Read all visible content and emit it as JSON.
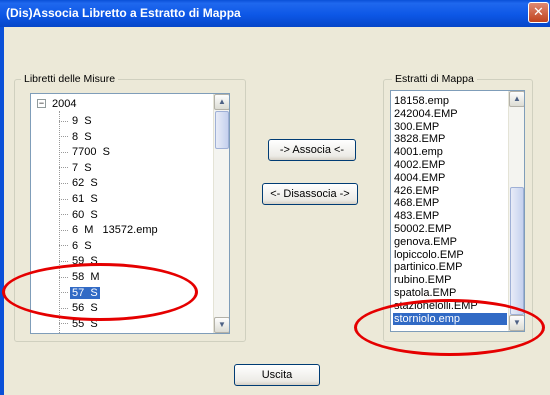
{
  "window": {
    "title": "(Dis)Associa Libretto a Estratto di Mappa",
    "close_glyph": "✕"
  },
  "left_group": {
    "label": "Libretti delle Misure",
    "root": {
      "expander": "−",
      "label": "2004"
    },
    "items": [
      {
        "label": "9  S",
        "selected": false
      },
      {
        "label": "8  S",
        "selected": false
      },
      {
        "label": "7700  S",
        "selected": false
      },
      {
        "label": "7  S",
        "selected": false
      },
      {
        "label": "62  S",
        "selected": false
      },
      {
        "label": "61  S",
        "selected": false
      },
      {
        "label": "60  S",
        "selected": false
      },
      {
        "label": "6  M   13572.emp",
        "selected": false
      },
      {
        "label": "6  S",
        "selected": false
      },
      {
        "label": "59  S",
        "selected": false
      },
      {
        "label": "58  M",
        "selected": false
      },
      {
        "label": "57  S",
        "selected": true
      },
      {
        "label": "56  S",
        "selected": false
      },
      {
        "label": "55  S",
        "selected": false
      }
    ]
  },
  "right_group": {
    "label": "Estratti di Mappa",
    "items": [
      {
        "label": "18158.emp",
        "selected": false
      },
      {
        "label": "242004.EMP",
        "selected": false
      },
      {
        "label": "300.EMP",
        "selected": false
      },
      {
        "label": "3828.EMP",
        "selected": false
      },
      {
        "label": "4001.emp",
        "selected": false
      },
      {
        "label": "4002.EMP",
        "selected": false
      },
      {
        "label": "4004.EMP",
        "selected": false
      },
      {
        "label": "426.EMP",
        "selected": false
      },
      {
        "label": "468.EMP",
        "selected": false
      },
      {
        "label": "483.EMP",
        "selected": false
      },
      {
        "label": "50002.EMP",
        "selected": false
      },
      {
        "label": "genova.EMP",
        "selected": false
      },
      {
        "label": "lopiccolo.EMP",
        "selected": false
      },
      {
        "label": "partinico.EMP",
        "selected": false
      },
      {
        "label": "rubino.EMP",
        "selected": false
      },
      {
        "label": "spatola.EMP",
        "selected": false
      },
      {
        "label": "stazionelolli.EMP",
        "selected": false
      },
      {
        "label": "storniolo.emp",
        "selected": true
      }
    ]
  },
  "buttons": {
    "associa": "-> Associa <-",
    "disassocia": "<- Disassocia ->",
    "uscita": "Uscita"
  },
  "scroll_arrows": {
    "up": "▲",
    "down": "▼"
  },
  "colors": {
    "title_bar": "#0a50d8",
    "selection": "#316ac5",
    "annotation": "#e50000"
  }
}
